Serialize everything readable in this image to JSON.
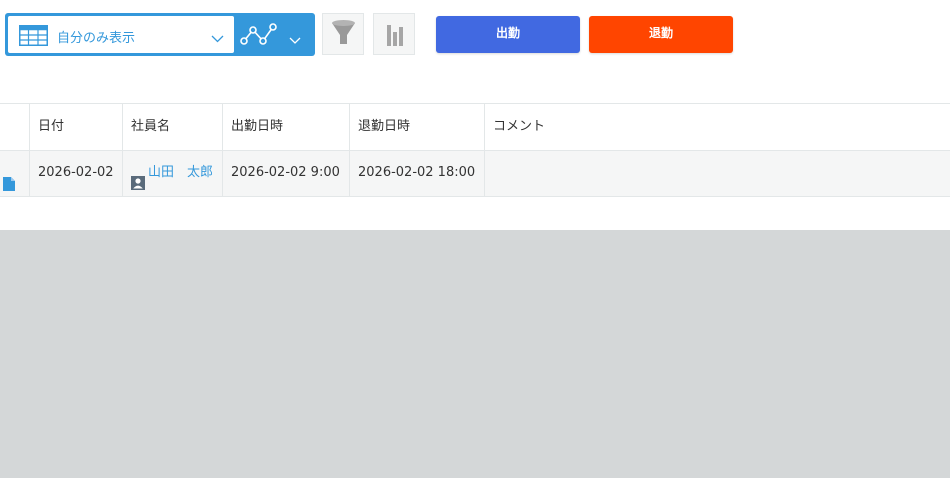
{
  "toolbar": {
    "view_label": "自分のみ表示",
    "clock_in_label": "出勤",
    "clock_out_label": "退勤",
    "icons": [
      "table-view-icon",
      "chevron-down-icon",
      "graph-icon",
      "filter-icon",
      "chart-icon"
    ]
  },
  "table": {
    "columns": [
      "日付",
      "社員名",
      "出勤日時",
      "退勤日時",
      "コメント"
    ],
    "rows": [
      {
        "date": "2026-02-02",
        "employee": "山田　太郎",
        "clock_in": "2026-02-02 9:00",
        "clock_out": "2026-02-02 18:00",
        "comment": ""
      }
    ]
  },
  "colors": {
    "accent": "#3498db",
    "clock_in_button": "#4169e1",
    "clock_out_button": "#ff4500",
    "gray_area": "#d4d7d8",
    "row_background": "#f5f6f6"
  }
}
